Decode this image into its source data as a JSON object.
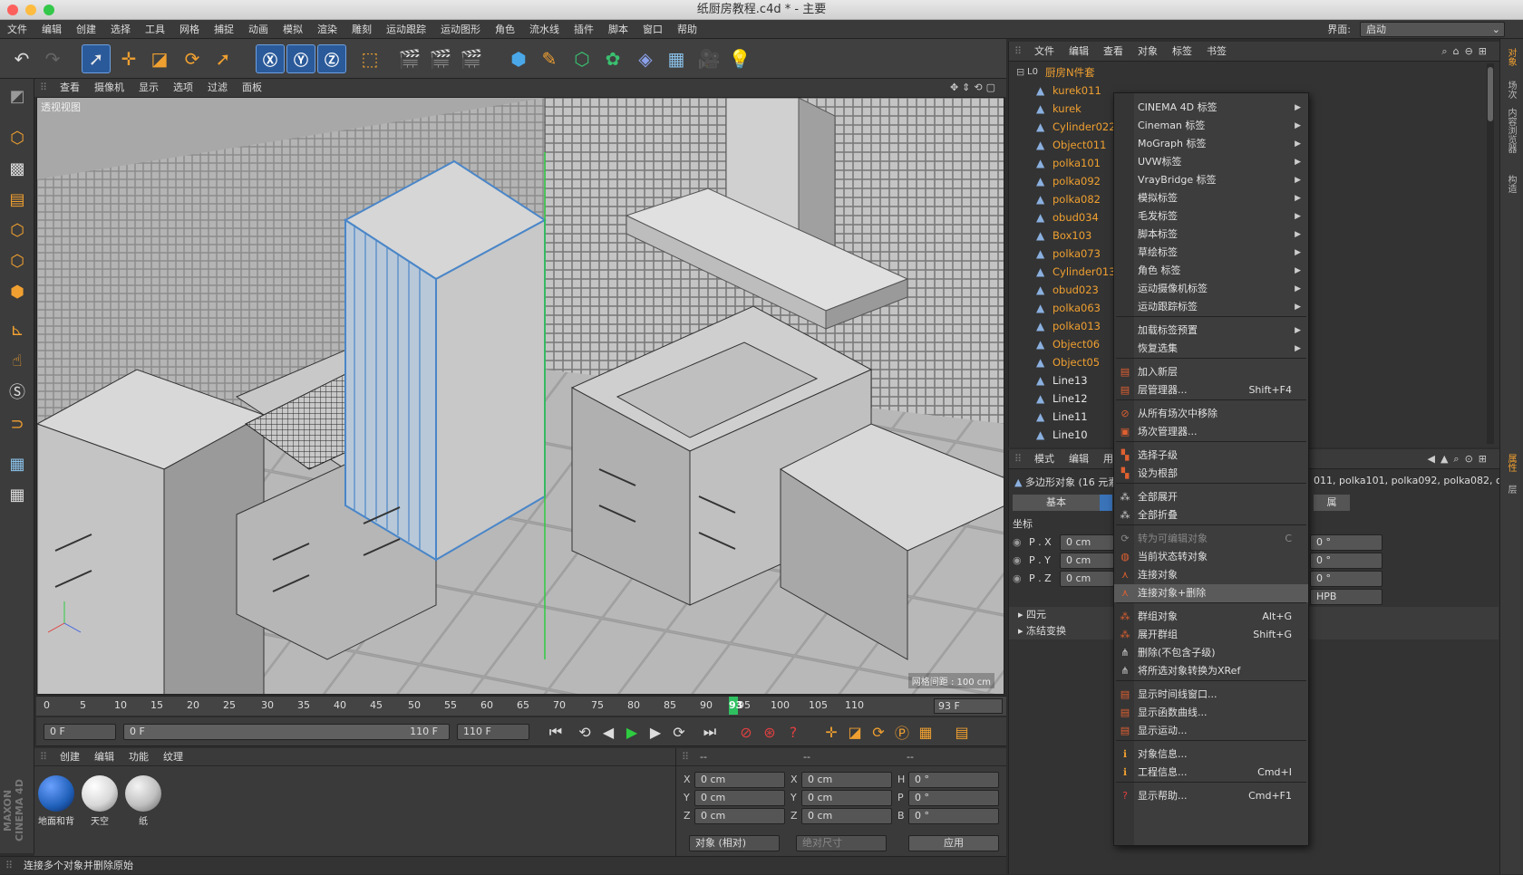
{
  "window": {
    "title": "纸厨房教程.c4d * - 主要"
  },
  "menubar": {
    "items": [
      "文件",
      "编辑",
      "创建",
      "选择",
      "工具",
      "网格",
      "捕捉",
      "动画",
      "模拟",
      "渲染",
      "雕刻",
      "运动跟踪",
      "运动图形",
      "角色",
      "流水线",
      "插件",
      "脚本",
      "窗口",
      "帮助"
    ],
    "layout_label": "界面:",
    "layout_value": "启动"
  },
  "viewport": {
    "menu": [
      "查看",
      "摄像机",
      "显示",
      "选项",
      "过滤",
      "面板"
    ],
    "view_name": "透视视图",
    "grid_label": "网格间距 : 100 cm"
  },
  "timeline": {
    "ticks": [
      "0",
      "5",
      "10",
      "15",
      "20",
      "25",
      "30",
      "35",
      "40",
      "45",
      "50",
      "55",
      "60",
      "65",
      "70",
      "75",
      "80",
      "85",
      "90",
      "95",
      "100",
      "105",
      "110"
    ],
    "current_frame": "93",
    "current_frame_box": "93 F"
  },
  "transport": {
    "start_frame": "0 F",
    "range_start": "0 F",
    "range_end": "110 F",
    "end_frame": "110 F"
  },
  "materials": {
    "menu": [
      "创建",
      "编辑",
      "功能",
      "纹理"
    ],
    "items": [
      {
        "name": "地面和背",
        "color": "#1f5fb8"
      },
      {
        "name": "天空",
        "color": "#e8e8e8"
      },
      {
        "name": "纸",
        "color": "#d0d0d0"
      }
    ]
  },
  "coords": {
    "pos_labels": [
      "X",
      "Y",
      "Z"
    ],
    "pos_values": [
      "0 cm",
      "0 cm",
      "0 cm"
    ],
    "size_labels": [
      "X",
      "Y",
      "Z"
    ],
    "size_values": [
      "0 cm",
      "0 cm",
      "0 cm"
    ],
    "rot_labels": [
      "H",
      "P",
      "B"
    ],
    "rot_values": [
      "0 °",
      "0 °",
      "0 °"
    ],
    "mode_left": "对象 (相对)",
    "mode_right": "绝对尺寸",
    "apply": "应用",
    "header": [
      "--",
      "--",
      "--"
    ]
  },
  "status": {
    "text": "连接多个对象并删除原始"
  },
  "brand": {
    "logo": "MAXON CINEMA 4D"
  },
  "object_manager": {
    "menu": [
      "文件",
      "编辑",
      "查看",
      "对象",
      "标签",
      "书签"
    ],
    "root": "厨房N件套",
    "objects": [
      {
        "name": "kurek011",
        "color": "orange"
      },
      {
        "name": "kurek",
        "color": "orange"
      },
      {
        "name": "Cylinder022",
        "color": "orange"
      },
      {
        "name": "Object011",
        "color": "orange"
      },
      {
        "name": "polka101",
        "color": "orange"
      },
      {
        "name": "polka092",
        "color": "orange"
      },
      {
        "name": "polka082",
        "color": "orange"
      },
      {
        "name": "obud034",
        "color": "orange"
      },
      {
        "name": "Box103",
        "color": "orange"
      },
      {
        "name": "polka073",
        "color": "orange"
      },
      {
        "name": "Cylinder013",
        "color": "orange"
      },
      {
        "name": "obud023",
        "color": "orange"
      },
      {
        "name": "polka063",
        "color": "orange"
      },
      {
        "name": "polka013",
        "color": "orange"
      },
      {
        "name": "Object06",
        "color": "orange"
      },
      {
        "name": "Object05",
        "color": "orange"
      },
      {
        "name": "Line13",
        "color": "white"
      },
      {
        "name": "Line12",
        "color": "white"
      },
      {
        "name": "Line11",
        "color": "white"
      },
      {
        "name": "Line10",
        "color": "white"
      }
    ]
  },
  "attributes": {
    "menu": [
      "模式",
      "编辑",
      "用户数据"
    ],
    "object_label": "多边形对象 (16 元素)",
    "selection_text": "011, polka101, polka092, polka082, obud0",
    "tab_basic": "基本",
    "tab_coords": "坐标",
    "tab_right": "属",
    "section_coords": "坐标",
    "fields": [
      {
        "label": "P . X",
        "value": "0 cm"
      },
      {
        "label": "P . Y",
        "value": "0 cm"
      },
      {
        "label": "P . Z",
        "value": "0 cm"
      }
    ],
    "rot_values": [
      "0 °",
      "0 °",
      "0 °"
    ],
    "order": "HPB",
    "section_quat": "四元",
    "section_freeze": "冻结变换"
  },
  "right_tabs": [
    "对象",
    "场次",
    "内容浏览器",
    "构造",
    "属性",
    "层"
  ],
  "context_menu": {
    "items": [
      {
        "label": "CINEMA 4D 标签",
        "submenu": true
      },
      {
        "label": "Cineman 标签",
        "submenu": true
      },
      {
        "label": "MoGraph 标签",
        "submenu": true
      },
      {
        "label": "UVW标签",
        "submenu": true
      },
      {
        "label": "VrayBridge 标签",
        "submenu": true
      },
      {
        "label": "模拟标签",
        "submenu": true
      },
      {
        "label": "毛发标签",
        "submenu": true
      },
      {
        "label": "脚本标签",
        "submenu": true
      },
      {
        "label": "草绘标签",
        "submenu": true
      },
      {
        "label": "角色 标签",
        "submenu": true
      },
      {
        "label": "运动摄像机标签",
        "submenu": true
      },
      {
        "label": "运动跟踪标签",
        "submenu": true
      },
      {
        "label": "加载标签预置",
        "submenu": true
      },
      {
        "label": "恢复选集",
        "submenu": true
      },
      {
        "label": "加入新层",
        "shortcut": ""
      },
      {
        "label": "层管理器...",
        "shortcut": "Shift+F4"
      },
      {
        "label": "从所有场次中移除",
        "shortcut": ""
      },
      {
        "label": "场次管理器...",
        "shortcut": ""
      },
      {
        "label": "选择子级",
        "shortcut": ""
      },
      {
        "label": "设为根部",
        "shortcut": ""
      },
      {
        "label": "全部展开",
        "shortcut": ""
      },
      {
        "label": "全部折叠",
        "shortcut": ""
      },
      {
        "label": "转为可编辑对象",
        "shortcut": "C",
        "disabled": true
      },
      {
        "label": "当前状态转对象",
        "shortcut": ""
      },
      {
        "label": "连接对象",
        "shortcut": ""
      },
      {
        "label": "连接对象+删除",
        "shortcut": "",
        "highlight": true
      },
      {
        "label": "群组对象",
        "shortcut": "Alt+G"
      },
      {
        "label": "展开群组",
        "shortcut": "Shift+G"
      },
      {
        "label": "删除(不包含子级)",
        "shortcut": ""
      },
      {
        "label": "将所选对象转换为XRef",
        "shortcut": ""
      },
      {
        "label": "显示时间线窗口...",
        "shortcut": ""
      },
      {
        "label": "显示函数曲线...",
        "shortcut": ""
      },
      {
        "label": "显示运动...",
        "shortcut": ""
      },
      {
        "label": "对象信息...",
        "shortcut": ""
      },
      {
        "label": "工程信息...",
        "shortcut": "Cmd+I"
      },
      {
        "label": "显示帮助...",
        "shortcut": "Cmd+F1"
      }
    ]
  }
}
